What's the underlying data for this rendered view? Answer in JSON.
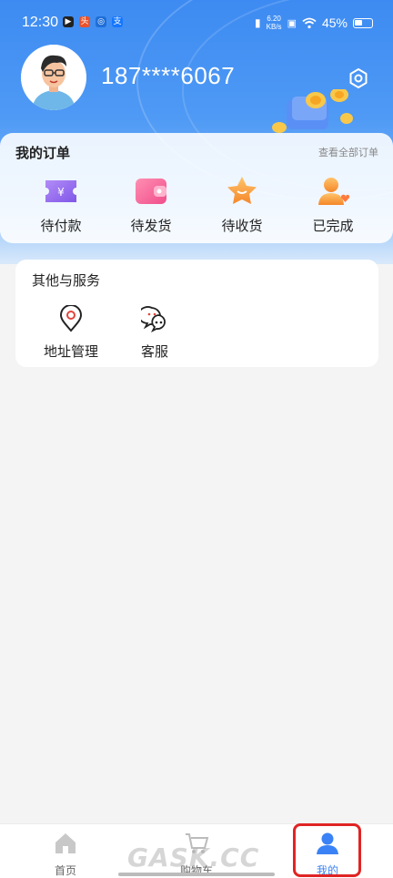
{
  "status_bar": {
    "time": "12:30",
    "net_speed_value": "6.20",
    "net_speed_unit": "KB/s",
    "battery": "45%"
  },
  "profile": {
    "phone": "187****6067"
  },
  "orders": {
    "title": "我的订单",
    "view_all": "查看全部订单",
    "items": [
      {
        "label": "待付款",
        "icon": "payment-ticket-icon"
      },
      {
        "label": "待发货",
        "icon": "wallet-icon"
      },
      {
        "label": "待收货",
        "icon": "star-icon"
      },
      {
        "label": "已完成",
        "icon": "user-heart-icon"
      }
    ]
  },
  "services": {
    "title": "其他与服务",
    "items": [
      {
        "label": "地址管理",
        "icon": "location-pin-icon"
      },
      {
        "label": "客服",
        "icon": "chat-icon"
      }
    ]
  },
  "tabbar": {
    "items": [
      {
        "label": "首页",
        "icon": "home-icon"
      },
      {
        "label": "购物车",
        "icon": "cart-icon"
      },
      {
        "label": "我的",
        "icon": "person-icon",
        "active": true
      }
    ]
  },
  "watermark": "GASK.CC",
  "colors": {
    "accent": "#3b82f6",
    "header_top": "#3d8bf2",
    "highlight": "#e02424"
  }
}
